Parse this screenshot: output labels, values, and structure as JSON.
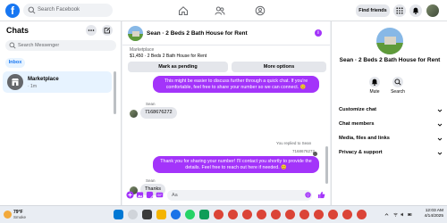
{
  "topbar": {
    "logo": "f",
    "search_placeholder": "Search Facebook",
    "find_friends": "Find friends",
    "icons": [
      "home-icon",
      "friends-icon",
      "groups-icon",
      "menu-grid-icon",
      "messenger-icon",
      "bell-icon"
    ]
  },
  "left": {
    "title": "Chats",
    "search_placeholder": "Search Messenger",
    "filter": "Inbox",
    "conversation": {
      "name": "Marketplace",
      "time": "· 1m"
    }
  },
  "conversation": {
    "title": "Sean · 2 Beds 2 Bath House for Rent",
    "marketplace_label": "Marketplace",
    "listing": "$1,450 · 2 Beds 2 Bath House for Rent",
    "mark_pending": "Mark as pending",
    "more_options": "More options",
    "messages": {
      "out1": "This might be easier to discuss further through a quick chat. If you're comfortable, feel free to share your number so we can connect. 😊",
      "sender1": "Sean",
      "in1": "7168676272",
      "reply_note": "You replied to Sean",
      "quoted": "7168676272",
      "out2": "Thank you for sharing your number! I'll contact you shortly to provide the details. Feel free to reach out here if needed. 😊",
      "sender2": "Sean",
      "in2": "Thanks"
    },
    "composer_placeholder": "Aa"
  },
  "right": {
    "title": "Sean · 2 Beds 2 Bath House for Rent",
    "mute": "Mute",
    "search": "Search",
    "rows": [
      "Customize chat",
      "Chat members",
      "Media, files and links",
      "Privacy & support"
    ]
  },
  "taskbar": {
    "temp": "79°F",
    "weather": "Smoke",
    "time": "12:03 AM",
    "date": "4/14/2025"
  },
  "colors": {
    "accent": "#a334fa",
    "facebook_blue": "#1877f2"
  }
}
